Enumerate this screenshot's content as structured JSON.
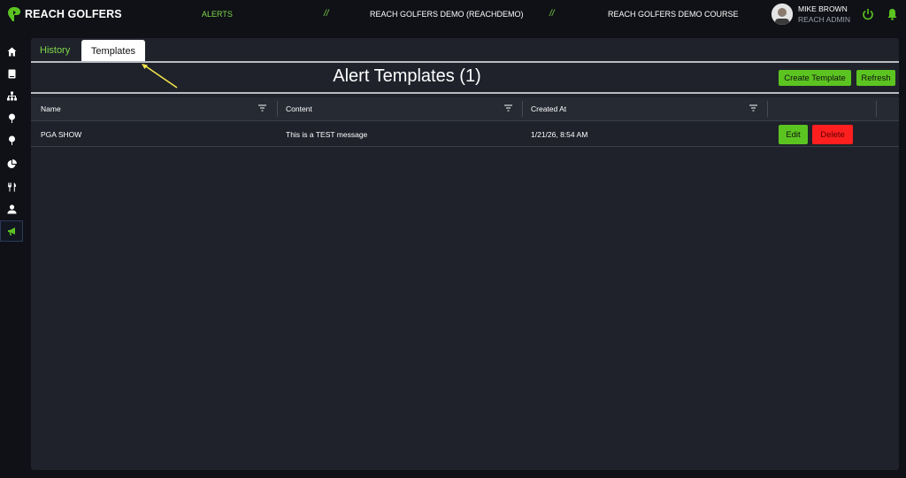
{
  "brand": {
    "name": "REACH GOLFERS",
    "accent": "#5cc421"
  },
  "topnav": {
    "section": "ALERTS",
    "separator": "//",
    "org": "REACH GOLFERS DEMO (REACHDEMO)",
    "course": "REACH GOLFERS DEMO COURSE"
  },
  "user": {
    "name": "MIKE BROWN",
    "role": "REACH ADMIN"
  },
  "sidebar": {
    "items": [
      {
        "icon": "home-icon"
      },
      {
        "icon": "book-icon"
      },
      {
        "icon": "hierarchy-icon"
      },
      {
        "icon": "pin-icon"
      },
      {
        "icon": "pin-icon"
      },
      {
        "icon": "pie-chart-icon"
      },
      {
        "icon": "utensils-icon"
      },
      {
        "icon": "user-icon"
      },
      {
        "icon": "megaphone-icon",
        "active": true
      }
    ]
  },
  "tabs": {
    "history": "History",
    "templates": "Templates",
    "active": "Templates"
  },
  "page": {
    "title": "Alert Templates (1)",
    "create_label": "Create Template",
    "refresh_label": "Refresh"
  },
  "table": {
    "columns": [
      "Name",
      "Content",
      "Created At",
      ""
    ],
    "rows": [
      {
        "name": "PGA SHOW",
        "content": "This is a TEST message",
        "created_at": "1/21/26, 8:54 AM",
        "edit_label": "Edit",
        "delete_label": "Delete"
      }
    ]
  },
  "colors": {
    "green": "#5cc421",
    "red": "#ff1f1f",
    "panel": "#1f222b",
    "annotation": "#f5e84a"
  }
}
